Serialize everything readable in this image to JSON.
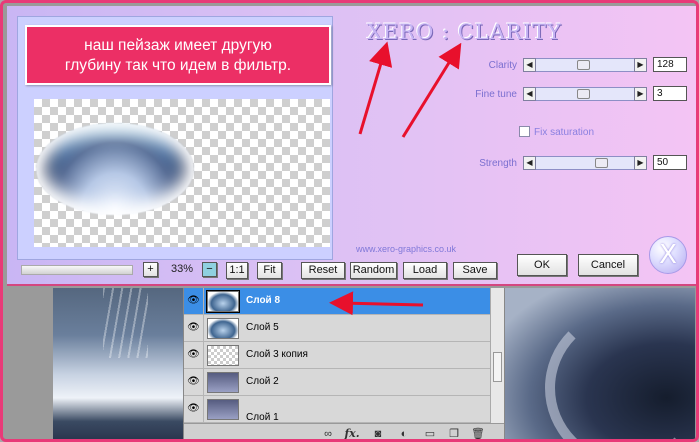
{
  "callout": {
    "line1": "наш пейзаж имеет другую",
    "line2": "глубину так что идем в фильтр."
  },
  "filter": {
    "logo": "XERO : CLARITY",
    "controls": [
      {
        "label": "Clarity",
        "value": "128",
        "fraction": 0.48
      },
      {
        "label": "Fine tune",
        "value": "3",
        "fraction": 0.48
      },
      {
        "label": "Strength",
        "value": "50",
        "fraction": 0.64
      }
    ],
    "fix_saturation": {
      "label": "Fix saturation",
      "checked": false
    },
    "url": "www.xero-graphics.co.uk",
    "zoom": {
      "plus": "+",
      "value": "33%",
      "minus": "−",
      "one_to_one": "1:1",
      "fit": "Fit"
    },
    "buttons": {
      "reset": "Reset",
      "random": "Random",
      "load": "Load",
      "save": "Save",
      "ok": "OK",
      "cancel": "Cancel"
    },
    "x_logo": "X"
  },
  "layers": {
    "rows": [
      {
        "name": "Слой 8",
        "selected": true,
        "thumb": "img"
      },
      {
        "name": "Слой 5",
        "selected": false,
        "thumb": "img"
      },
      {
        "name": "Слой 3 копия",
        "selected": false,
        "thumb": "checker"
      },
      {
        "name": "Слой 2",
        "selected": false,
        "thumb": "dark"
      },
      {
        "name": "Слой 1",
        "selected": false,
        "thumb": "dark"
      }
    ],
    "toolbar_icons": [
      "link-icon",
      "fx-icon",
      "mask-icon",
      "adjustment-icon",
      "folder-icon",
      "new-layer-icon",
      "trash-icon"
    ],
    "fx_label": "fx."
  },
  "colors": {
    "accent": "#ec2f65",
    "selection": "#3b8ee6",
    "arrow": "#e8102c"
  }
}
